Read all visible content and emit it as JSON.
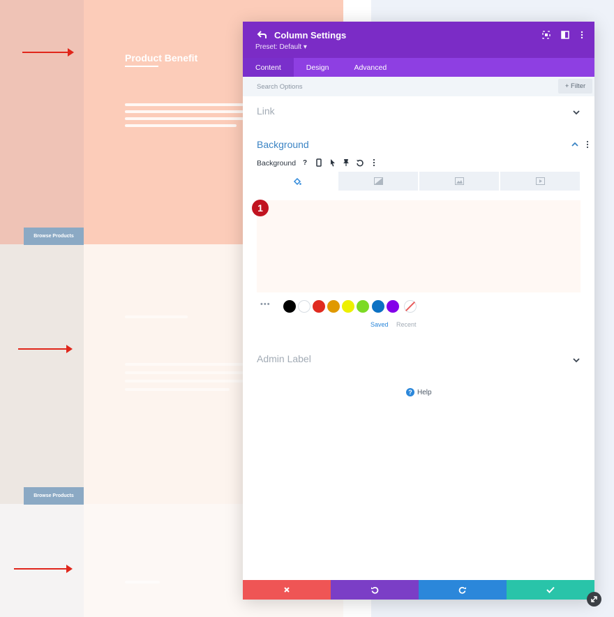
{
  "page": {
    "rows": [
      {
        "button_label": "Browse Products"
      },
      {
        "button_label": "Browse Products"
      }
    ],
    "product_title": "Product Benefit"
  },
  "modal": {
    "title": "Column Settings",
    "preset": "Preset: Default ▾",
    "tabs": [
      {
        "label": "Content"
      },
      {
        "label": "Design"
      },
      {
        "label": "Advanced"
      }
    ],
    "search_placeholder": "Search Options",
    "filter_label": "+ Filter",
    "sections": {
      "link": "Link",
      "background": "Background",
      "admin_label": "Admin Label"
    },
    "background_field_label": "Background",
    "background_tools": [
      "help-icon",
      "mobile-icon",
      "cursor-icon",
      "pin-icon",
      "reset-icon",
      "more-icon"
    ],
    "background_types": [
      "color-fill-icon",
      "gradient-icon",
      "image-icon",
      "video-icon"
    ],
    "preview_color": "#fff8f4",
    "annotation_badge": "1",
    "swatches": [
      "#000000",
      "#ffffff",
      "#e02b20",
      "#e09900",
      "#edf000",
      "#7cda24",
      "#0c71c3",
      "#8300e9"
    ],
    "swatch_tabs": {
      "saved": "Saved",
      "recent": "Recent"
    },
    "help_label": "Help",
    "footer": {
      "discard_color": "#ef5555",
      "undo_color": "#7b3ec6",
      "redo_color": "#2b87da",
      "save_color": "#29c4a9"
    }
  }
}
